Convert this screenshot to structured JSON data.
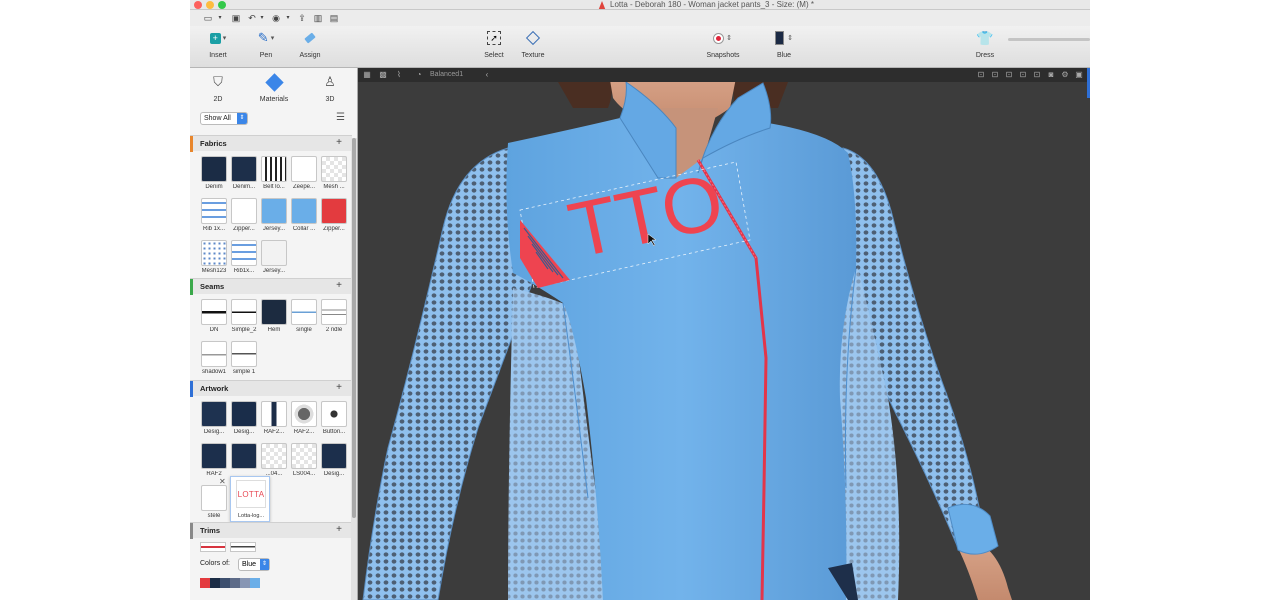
{
  "window": {
    "title": "Lotta - Deborah 180 - Woman jacket pants_3 - Size: (M) *"
  },
  "toolbar": {
    "insert": "Insert",
    "pen": "Pen",
    "assign": "Assign",
    "select": "Select",
    "texture": "Texture",
    "snapshots": "Snapshots",
    "color_name": "Blue",
    "dress": "Dress"
  },
  "modes": {
    "tab_2d": "2D",
    "tab_materials": "Materials",
    "tab_3d": "3D"
  },
  "filter": {
    "value": "Show All"
  },
  "sections": {
    "fabrics": "Fabrics",
    "seams": "Seams",
    "artwork": "Artwork",
    "trims": "Trims"
  },
  "fabrics": [
    {
      "label": "Denim"
    },
    {
      "label": "Denim..."
    },
    {
      "label": "Belt lo..."
    },
    {
      "label": "Zeepe..."
    },
    {
      "label": "Mesh ..."
    },
    {
      "label": "Rib 1x..."
    },
    {
      "label": "Zipper..."
    },
    {
      "label": "Jersey..."
    },
    {
      "label": "Collar ..."
    },
    {
      "label": "Zipper..."
    },
    {
      "label": "Mesh123"
    },
    {
      "label": "Rib1x..."
    },
    {
      "label": "Jersey..."
    }
  ],
  "seams": [
    {
      "label": "DN"
    },
    {
      "label": "Simple_2"
    },
    {
      "label": "Hem"
    },
    {
      "label": "single"
    },
    {
      "label": "2 ndle"
    },
    {
      "label": "shadow1"
    },
    {
      "label": "simple 1"
    }
  ],
  "artwork": [
    {
      "label": "Desig..."
    },
    {
      "label": "Desig..."
    },
    {
      "label": "RAF2..."
    },
    {
      "label": "RAF2..."
    },
    {
      "label": "Button..."
    },
    {
      "label": "RAF2"
    },
    {
      "label": ""
    },
    {
      "label": "...04..."
    },
    {
      "label": "LS004..."
    },
    {
      "label": "Desig..."
    },
    {
      "label": "stele"
    }
  ],
  "drag_popup": {
    "thumb_text": "LOTTA",
    "label": "Lotta-log..."
  },
  "trims_footer": {
    "colors_of_label": "Colors of:",
    "colors_of_value": "Blue"
  },
  "viewport": {
    "display_mode": "Balanced1",
    "logo_text": "TTO"
  },
  "colors": {
    "jacket": "#6aaee8",
    "logo_red": "#ee4450",
    "background": "#3c3c3c"
  }
}
